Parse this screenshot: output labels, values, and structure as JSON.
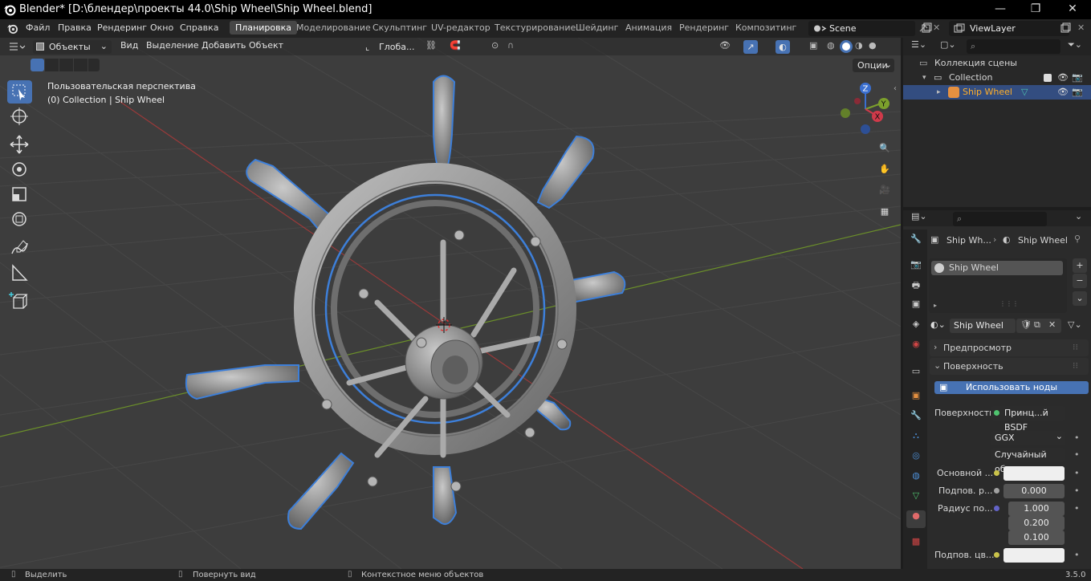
{
  "window": {
    "title": "Blender* [D:\\блендер\\проекты 44.0\\Ship Wheel\\Ship Wheel.blend]",
    "minimize": "—",
    "maximize": "❐",
    "close": "✕"
  },
  "menu": {
    "file": "Файл",
    "edit": "Правка",
    "render": "Рендеринг",
    "window": "Окно",
    "help": "Справка"
  },
  "workspaces": [
    "Планировка",
    "Моделирование",
    "Скульптинг",
    "UV-редактор",
    "Текстурирование",
    "Шейдинг",
    "Анимация",
    "Рендеринг",
    "Композитинг"
  ],
  "scene": {
    "name": "Scene",
    "view_layer": "ViewLayer"
  },
  "viewport_header": {
    "mode": "Объекты",
    "view": "Вид",
    "select": "Выделение",
    "add": "Добавить",
    "object": "Объект",
    "transform": "Глоба...",
    "options": "Опции"
  },
  "viewport_overlay": {
    "view_name": "Пользовательская перспектива",
    "collection_info": "(0) Collection | Ship Wheel"
  },
  "gizmo": {
    "x": "X",
    "y": "Y",
    "z": "Z"
  },
  "outliner": {
    "scene_collection": "Коллекция сцены",
    "collection": "Collection",
    "object": "Ship Wheel"
  },
  "properties": {
    "breadcrumb_obj": "Ship Wh...",
    "breadcrumb_mat": "Ship Wheel",
    "slot_name": "Ship Wheel",
    "material_name": "Ship Wheel",
    "preview": "Предпросмотр",
    "surface_panel": "Поверхность",
    "use_nodes": "Использовать ноды",
    "surface_label": "Поверхность",
    "surface_value": "Принц...й BSDF",
    "distribution": "GGX",
    "subsurface_method": "Случайный об...",
    "base_color_label": "Основной ...",
    "subsurface_label": "Подпов. р...",
    "subsurface_value": "0.000",
    "radius_label": "Радиус по...",
    "radius_values": [
      "1.000",
      "0.200",
      "0.100"
    ],
    "subsurface_color_label": "Подпов. цв..."
  },
  "status": {
    "select": "Выделить",
    "rotate": "Повернуть вид",
    "context": "Контекстное меню объектов",
    "version": "3.5.0"
  },
  "colors": {
    "accent": "#4772b3",
    "selection_outline": "#3d7fd9",
    "grid_x": "#9a3a3a",
    "grid_y": "#6b8f2a"
  }
}
